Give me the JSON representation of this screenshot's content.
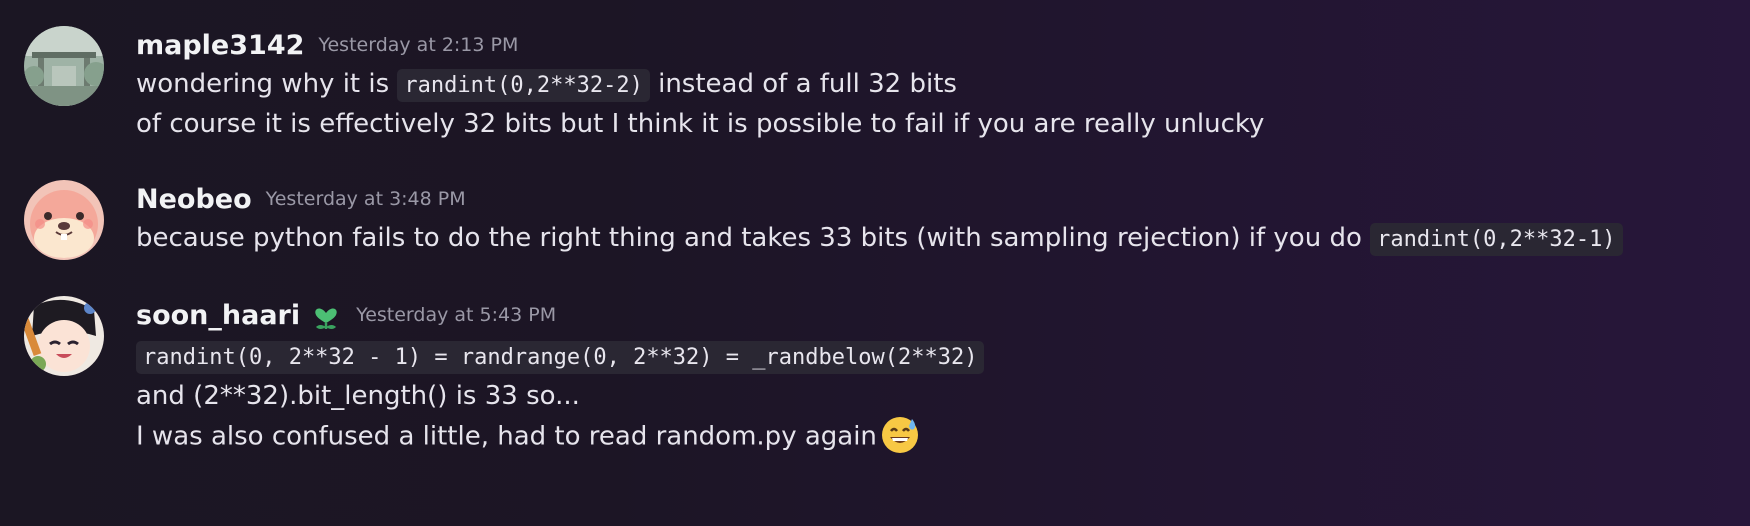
{
  "messages": [
    {
      "username": "maple3142",
      "timestamp": "Yesterday at 2:13 PM",
      "line1_before": "wondering why it is ",
      "line1_code": "randint(0,2**32-2)",
      "line1_after": " instead of a full 32 bits",
      "line2": "of course it is effectively 32 bits but I think it is possible to fail if you are really unlucky"
    },
    {
      "username": "Neobeo",
      "timestamp": "Yesterday at 3:48 PM",
      "line1_before": "because python fails to do the right thing and takes 33 bits (with sampling rejection) if you do ",
      "line1_code": "randint(0,2**32-1)"
    },
    {
      "username": "soon_haari",
      "badge_icon": "green-heart-flower-badge",
      "timestamp": "Yesterday at 5:43 PM",
      "line1_code": "randint(0, 2**32 - 1) = randrange(0, 2**32) = _randbelow(2**32)",
      "line2": "and (2**32).bit_length() is 33 so...",
      "line3": "I was also confused a little, had to read random.py again",
      "line3_emoji": "sweat-smile-emoji"
    }
  ]
}
